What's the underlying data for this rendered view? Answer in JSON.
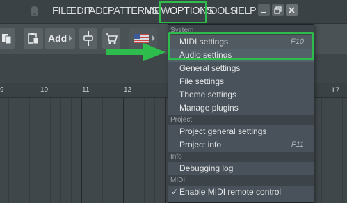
{
  "colors": {
    "accent_highlight": "#2ebd4d"
  },
  "menubar": {
    "items": [
      "FILE",
      "EDIT",
      "ADD",
      "PATTERNS",
      "VIEW",
      "OPTIONS",
      "TOOLS",
      "HELP"
    ]
  },
  "toolbar": {
    "add_label": "Add"
  },
  "ruler": {
    "labels": [
      "9",
      "10",
      "11",
      "12",
      "17"
    ]
  },
  "dropdown": {
    "sections": [
      {
        "header": "System",
        "items": [
          {
            "label": "MIDI settings",
            "shortcut": "F10"
          },
          {
            "label": "Audio settings",
            "shortcut": ""
          },
          {
            "label": "General settings",
            "shortcut": ""
          },
          {
            "label": "File settings",
            "shortcut": ""
          },
          {
            "label": "Theme settings",
            "shortcut": ""
          },
          {
            "label": "Manage plugins",
            "shortcut": ""
          }
        ]
      },
      {
        "header": "Project",
        "items": [
          {
            "label": "Project general settings",
            "shortcut": ""
          },
          {
            "label": "Project info",
            "shortcut": "F11"
          }
        ]
      },
      {
        "header": "Info",
        "items": [
          {
            "label": "Debugging log",
            "shortcut": ""
          }
        ]
      },
      {
        "header": "MIDI",
        "items": [
          {
            "label": "Enable MIDI remote control",
            "shortcut": "",
            "checked": true
          }
        ]
      }
    ]
  }
}
